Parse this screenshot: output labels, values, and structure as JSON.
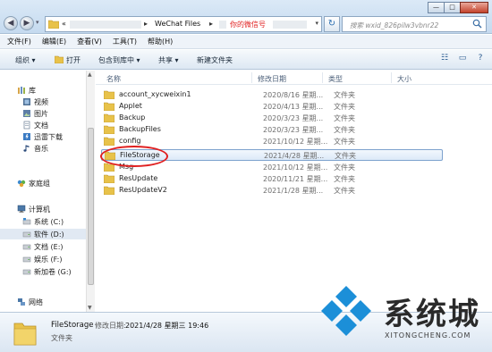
{
  "address_bar": {
    "crumb_prefix": "«",
    "crumbs": [
      "WeChat Files",
      "你的微信号"
    ],
    "search_placeholder": "搜索 wxid_826pilw3vbnr22"
  },
  "window_buttons": [
    "—",
    "□",
    "✕"
  ],
  "menubar": [
    "文件(F)",
    "编辑(E)",
    "查看(V)",
    "工具(T)",
    "帮助(H)"
  ],
  "toolbar": {
    "organize": "组织 ▾",
    "open": "打开",
    "include_library": "包含到库中 ▾",
    "share": "共享 ▾",
    "new_folder": "新建文件夹"
  },
  "nav": {
    "library": "库",
    "video": "视频",
    "pictures": "图片",
    "documents": "文档",
    "thunder": "迅雷下载",
    "music": "音乐",
    "homegroup": "家庭组",
    "computer": "计算机",
    "drive_c": "系统 (C:)",
    "drive_d": "软件 (D:)",
    "drive_e": "文档 (E:)",
    "drive_f": "娱乐 (F:)",
    "drive_g": "新加卷 (G:)",
    "network": "网络"
  },
  "columns": {
    "name": "名称",
    "date": "修改日期",
    "type": "类型",
    "size": "大小"
  },
  "files": [
    {
      "name": "account_xycweixin1",
      "date": "2020/8/16 星期...",
      "type": "文件夹"
    },
    {
      "name": "Applet",
      "date": "2020/4/13 星期...",
      "type": "文件夹"
    },
    {
      "name": "Backup",
      "date": "2020/3/23 星期...",
      "type": "文件夹"
    },
    {
      "name": "BackupFiles",
      "date": "2020/3/23 星期...",
      "type": "文件夹"
    },
    {
      "name": "config",
      "date": "2021/10/12 星期...",
      "type": "文件夹"
    },
    {
      "name": "FileStorage",
      "date": "2021/4/28 星期...",
      "type": "文件夹"
    },
    {
      "name": "Msg",
      "date": "2021/10/12 星期...",
      "type": "文件夹"
    },
    {
      "name": "ResUpdate",
      "date": "2020/11/21 星期...",
      "type": "文件夹"
    },
    {
      "name": "ResUpdateV2",
      "date": "2021/1/28 星期...",
      "type": "文件夹"
    }
  ],
  "details": {
    "name": "FileStorage",
    "modified_label": "修改日期:",
    "modified": "2021/4/28 星期三 19:46",
    "type": "文件夹"
  },
  "watermark": {
    "cn": "系统城",
    "en": "XITONGCHENG.COM"
  },
  "colors": {
    "accent_red": "#e02020",
    "folder_yellow": "#e8c24a",
    "selection_border": "#7da2ce",
    "watermark_blue": "#1c8fd8"
  }
}
